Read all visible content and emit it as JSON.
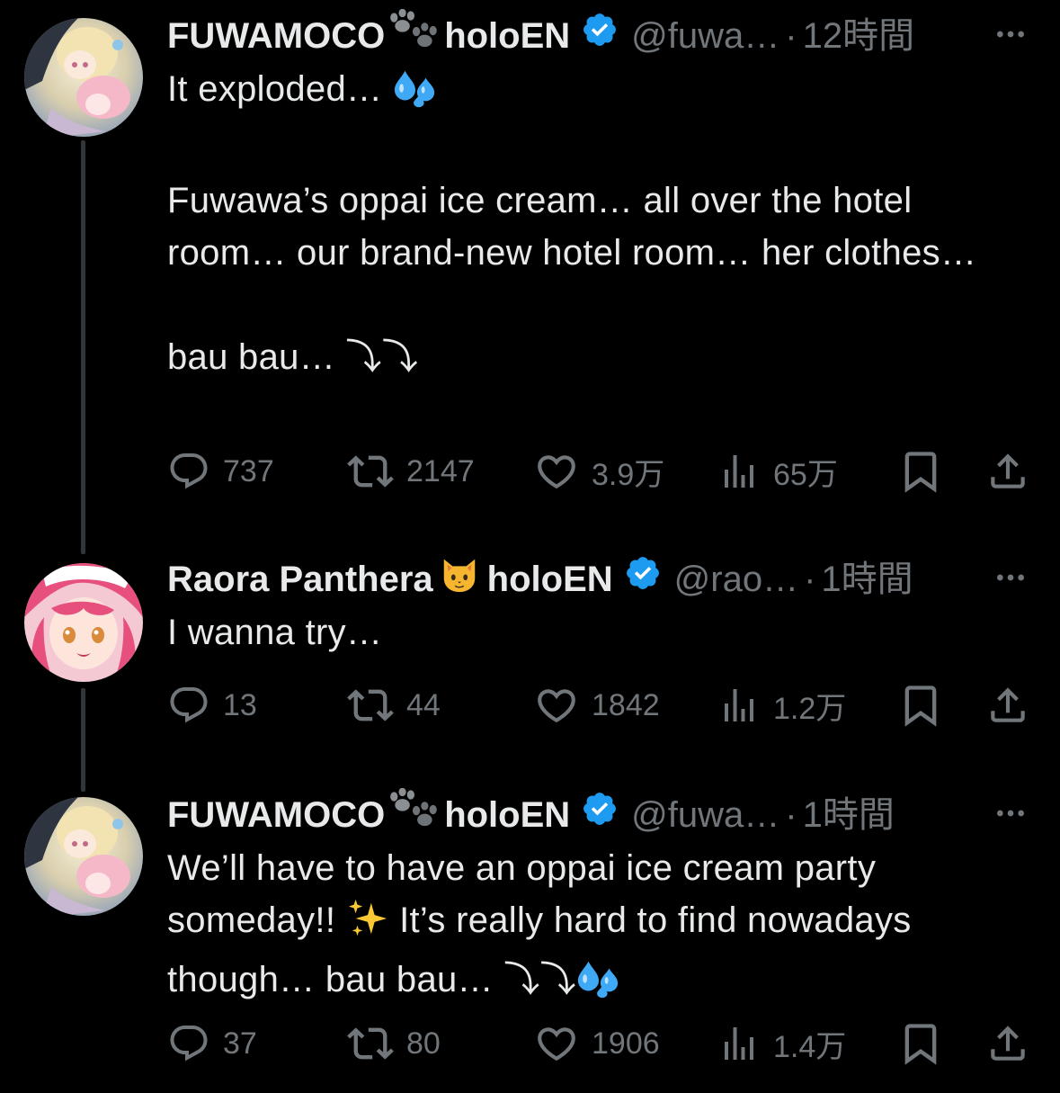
{
  "colors": {
    "background": "#000000",
    "text_primary": "#e7e9ea",
    "text_secondary": "#71767b",
    "verified_badge": "#1d9bf0",
    "thread_line": "#333639"
  },
  "tweets": [
    {
      "display_name": "FUWAMOCO",
      "name_emoji": "paw-prints",
      "name_suffix": "holoEN",
      "verified": true,
      "handle": "@fuwa…",
      "dot": "·",
      "time": "12時間",
      "text_lines": [
        "It exploded…",
        "",
        "Fuwawa’s oppai ice cream… all over the hotel room… our brand-new hotel room… her clothes…",
        "",
        "bau bau… ⤵⤵"
      ],
      "stats": {
        "replies": "737",
        "reposts": "2147",
        "likes": "3.9万",
        "views": "65万"
      }
    },
    {
      "display_name": "Raora Panthera",
      "name_emoji": "cat-face",
      "name_suffix": "holoEN",
      "verified": true,
      "handle": "@rao…",
      "dot": "·",
      "time": "1時間",
      "text_lines": [
        "I wanna try…"
      ],
      "stats": {
        "replies": "13",
        "reposts": "44",
        "likes": "1842",
        "views": "1.2万"
      }
    },
    {
      "display_name": "FUWAMOCO",
      "name_emoji": "paw-prints",
      "name_suffix": "holoEN",
      "verified": true,
      "handle": "@fuwa…",
      "dot": "·",
      "time": "1時間",
      "text_lines": [
        "We’ll have to have an oppai ice cream party someday!!",
        "It’s really hard to find nowadays though… bau bau… ⤵⤵"
      ],
      "stats": {
        "replies": "37",
        "reposts": "80",
        "likes": "1906",
        "views": "1.4万"
      }
    }
  ]
}
